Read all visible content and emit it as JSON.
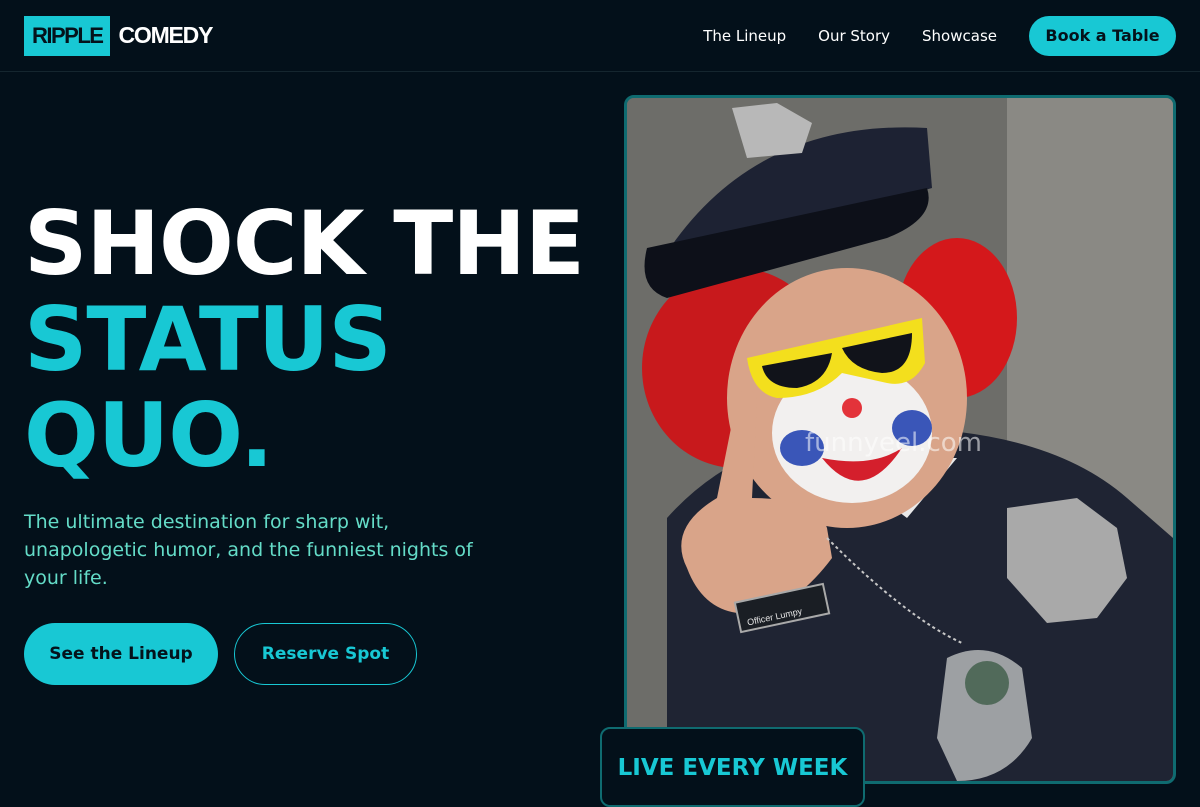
{
  "brand": {
    "badge": "RIPPLE",
    "word": "COMEDY"
  },
  "nav": {
    "items": [
      "The Lineup",
      "Our Story",
      "Showcase"
    ],
    "cta": "Book a Table"
  },
  "hero": {
    "headline": [
      "SHOCK THE",
      "STATUS",
      "QUO."
    ],
    "subtext": "The ultimate destination for sharp wit, unapologetic humor, and the funniest nights of your life.",
    "primary_button": "See the Lineup",
    "secondary_button": "Reserve Spot",
    "image_watermark": "funnyeel.com",
    "name_tag": "Officer Lumpy",
    "badge": "LIVE EVERY WEEK"
  },
  "colors": {
    "accent": "#18c8d4",
    "background": "#03101a",
    "subtext": "#64dcc8"
  }
}
